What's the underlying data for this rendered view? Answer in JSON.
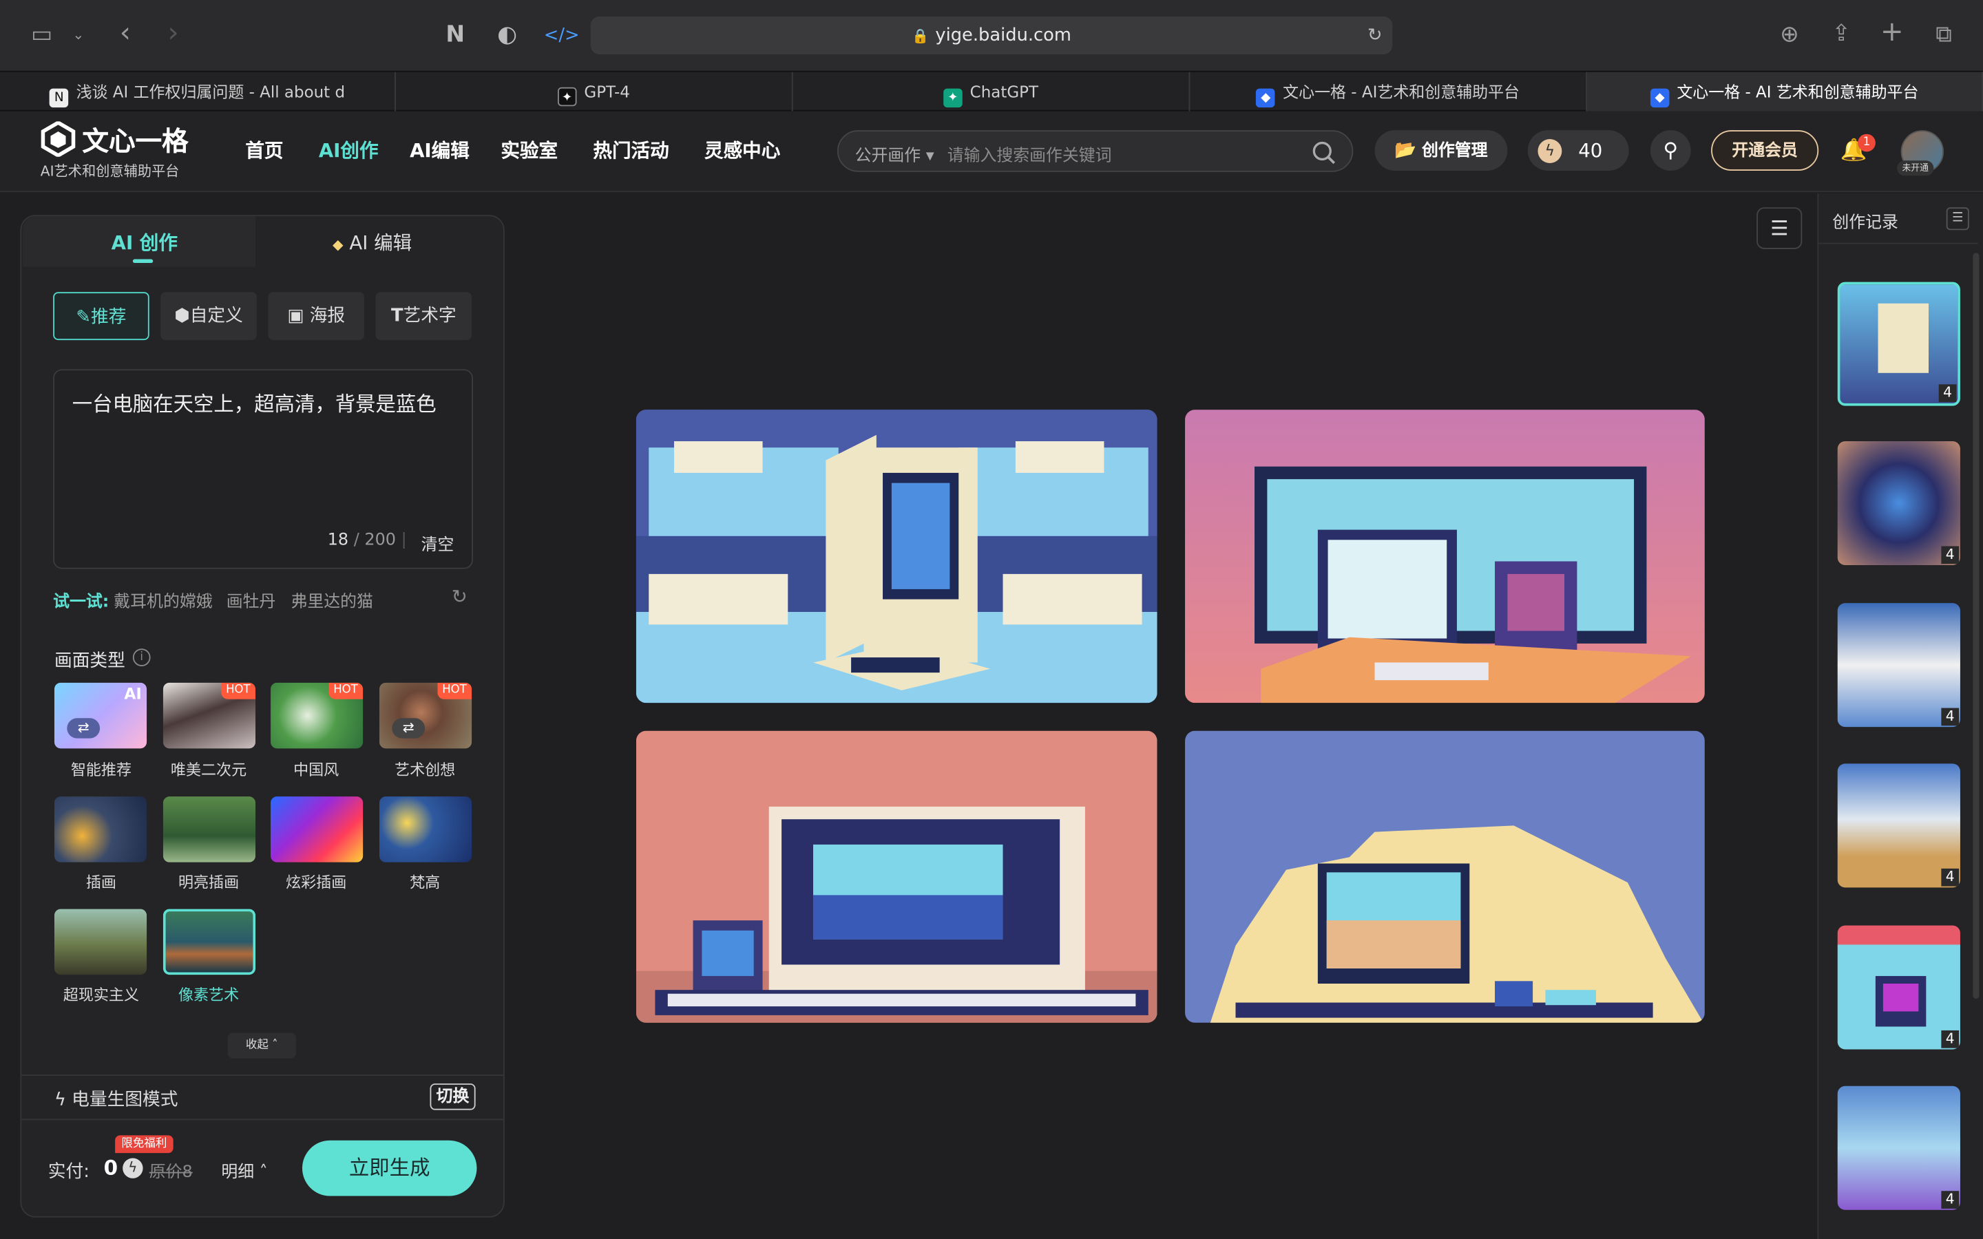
{
  "browser": {
    "url": "yige.baidu.com",
    "tabs": [
      {
        "title": "浅谈 AI 工作权归属问题 - All about d",
        "favicon": "N"
      },
      {
        "title": "GPT-4",
        "favicon": "openai"
      },
      {
        "title": "ChatGPT",
        "favicon": "openai"
      },
      {
        "title": "文心一格 - AI艺术和创意辅助平台",
        "favicon": "yige"
      },
      {
        "title": "文心一格 - AI 艺术和创意辅助平台",
        "favicon": "yige",
        "active": true
      }
    ]
  },
  "site": {
    "logo_text": "文心一格",
    "logo_sub": "AI艺术和创意辅助平台",
    "nav": [
      "首页",
      "AI创作",
      "AI编辑",
      "实验室",
      "热门活动",
      "灵感中心"
    ],
    "nav_active": "AI创作",
    "search_scope": "公开画作",
    "search_placeholder": "请输入搜索画作关键词",
    "manage_label": "创作管理",
    "points": "40",
    "vip_label": "开通会员",
    "notif_count": "1",
    "avatar_badge": "未开通"
  },
  "left": {
    "tab_create": "AI 创作",
    "tab_edit": "AI 编辑",
    "modes": [
      "推荐",
      "自定义",
      "海报",
      "艺术字"
    ],
    "prompt_text": "一台电脑在天空上，超高清，背景是蓝色",
    "char_count": "18",
    "char_max": "200",
    "clear_label": "清空",
    "try_label": "试一试:",
    "suggestions": [
      "戴耳机的嫦娥",
      "画牡丹",
      "弗里达的猫"
    ],
    "style_section": "画面类型",
    "styles": [
      {
        "label": "智能推荐",
        "badge": "AI"
      },
      {
        "label": "唯美二次元",
        "badge": "HOT"
      },
      {
        "label": "中国风",
        "badge": "HOT"
      },
      {
        "label": "艺术创想",
        "badge": "HOT"
      },
      {
        "label": "插画",
        "badge": ""
      },
      {
        "label": "明亮插画",
        "badge": ""
      },
      {
        "label": "炫彩插画",
        "badge": ""
      },
      {
        "label": "梵高",
        "badge": ""
      },
      {
        "label": "超现实主义",
        "badge": ""
      },
      {
        "label": "像素艺术",
        "badge": "",
        "selected": true
      }
    ],
    "collapse_label": "收起",
    "power_mode": "电量生图模式",
    "switch_label": "切换",
    "promo_tag": "限免福利",
    "pay_label": "实付:",
    "pay_value": "0",
    "orig_price": "原价8",
    "detail_label": "明细",
    "generate_label": "立即生成"
  },
  "history": {
    "title": "创作记录",
    "counts": [
      "4",
      "4",
      "4",
      "4",
      "4",
      "4"
    ]
  },
  "colors": {
    "accent": "#5ee0d3",
    "bg": "#1f1f21",
    "panel": "#242426"
  }
}
